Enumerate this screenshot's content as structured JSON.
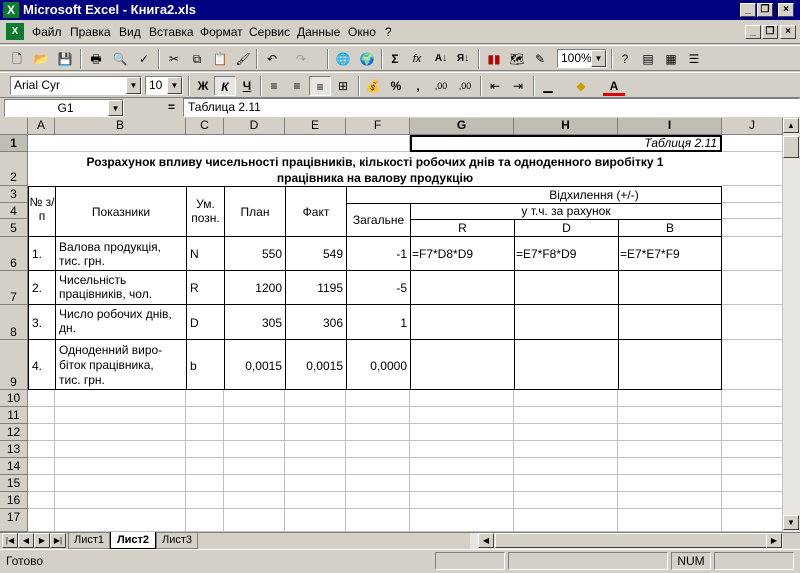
{
  "window": {
    "title": "Microsoft Excel - Книга2.xls"
  },
  "menu": {
    "items": [
      "Файл",
      "Правка",
      "Вид",
      "Вставка",
      "Формат",
      "Сервис",
      "Данные",
      "Окно",
      "?"
    ]
  },
  "toolbar": {
    "zoom": "100%",
    "font": "Arial Cyr",
    "size": "10",
    "bold": "Ж",
    "italic": "К",
    "underline": "Ч",
    "percent": "%",
    "dec_inc": ",00",
    "dec_dec": ",00",
    "sigma": "Σ",
    "fx": "fx"
  },
  "formula_bar": {
    "name_box": "G1",
    "eq": "=",
    "content": "Таблица 2.11"
  },
  "columns": [
    "A",
    "B",
    "C",
    "D",
    "E",
    "F",
    "G",
    "H",
    "I",
    "J"
  ],
  "rows": [
    "1",
    "2",
    "3",
    "4",
    "5",
    "6",
    "7",
    "8",
    "9",
    "10",
    "11",
    "12",
    "13",
    "14",
    "15",
    "16",
    "17"
  ],
  "sheet": {
    "g1": "Таблиця 2.11",
    "title_line1": "Розрахунок впливу чисельності працівників, кількості робочих днів та одноденного виробітку 1",
    "title_line2": "працівника на валову продукцію",
    "h_num": "№ з/п",
    "h_indicators": "Показники",
    "h_unit": "Ум. позн.",
    "h_plan": "План",
    "h_fact": "Факт",
    "h_dev": "Відхилення (+/-)",
    "h_total": "Загальне",
    "h_incl": "у т.ч. за рахунок",
    "h_R": "R",
    "h_D": "D",
    "h_B": "B",
    "r6": {
      "n": "1.",
      "name": [
        "Валова продукція,",
        "тис. грн."
      ],
      "u": "N",
      "plan": "550",
      "fact": "549",
      "total": "-1",
      "g": "=F7*D8*D9",
      "h": "=E7*F8*D9",
      "i": "=E7*E7*F9"
    },
    "r7": {
      "n": "2.",
      "name": [
        "Чисельність",
        "працівників, чол."
      ],
      "u": "R",
      "plan": "1200",
      "fact": "1195",
      "total": "-5"
    },
    "r8": {
      "n": "3.",
      "name": [
        "Число робочих днів,",
        "дн."
      ],
      "u": "D",
      "plan": "305",
      "fact": "306",
      "total": "1"
    },
    "r9": {
      "n": "4.",
      "name": [
        "Одноденний виро-",
        "біток працівника,",
        "тис. грн."
      ],
      "u": "b",
      "plan": "0,0015",
      "fact": "0,0015",
      "total": "0,0000"
    }
  },
  "tabs": [
    "Лист1",
    "Лист2",
    "Лист3"
  ],
  "status": {
    "ready": "Готово",
    "num": "NUM"
  }
}
